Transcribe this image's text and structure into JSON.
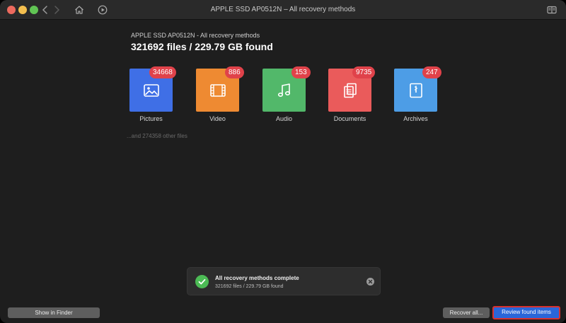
{
  "window": {
    "title": "APPLE SSD AP0512N – All recovery methods"
  },
  "toolbar": {
    "icons": [
      "chevron-left-icon",
      "chevron-right-icon",
      "home-icon",
      "recovery-play-icon",
      "sidebar-icon"
    ]
  },
  "summary": {
    "subtitle": "APPLE SSD AP0512N - All recovery methods",
    "headline": "321692 files / 229.79 GB found",
    "other_files": "...and 274358 other files"
  },
  "categories": [
    {
      "label": "Pictures",
      "count": "34668",
      "icon": "picture-icon",
      "color": "#3f6fe6"
    },
    {
      "label": "Video",
      "count": "886",
      "icon": "film-icon",
      "color": "#ee8a32"
    },
    {
      "label": "Audio",
      "count": "153",
      "icon": "music-note-icon",
      "color": "#52b86a"
    },
    {
      "label": "Documents",
      "count": "9735",
      "icon": "documents-icon",
      "color": "#ea5b5b"
    },
    {
      "label": "Archives",
      "count": "247",
      "icon": "archive-icon",
      "color": "#4d9de6"
    }
  ],
  "toast": {
    "title": "All recovery methods complete",
    "subtitle": "321692 files / 229.79 GB found"
  },
  "buttons": {
    "show_in_finder": "Show in Finder",
    "recover_all": "Recover all...",
    "review_found_items": "Review found items"
  },
  "colors": {
    "badge": "#e0424a",
    "primary_button": "#2a66d9",
    "success": "#4cbb55"
  }
}
